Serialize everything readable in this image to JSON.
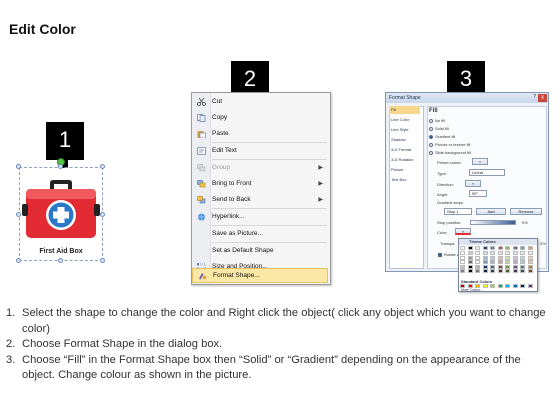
{
  "page_title": "Edit Color",
  "badges": [
    "1",
    "2",
    "3"
  ],
  "panel1": {
    "shape_label": "First Aid Box"
  },
  "context_menu": {
    "items": [
      {
        "label": "Cut",
        "icon": "scissors-icon",
        "arrow": false,
        "disabled": false
      },
      {
        "label": "Copy",
        "icon": "copy-icon",
        "arrow": false,
        "disabled": false
      },
      {
        "label": "Paste",
        "icon": "paste-icon",
        "arrow": false,
        "disabled": false
      },
      {
        "label": "Edit Text",
        "icon": "edit-text-icon",
        "arrow": false,
        "disabled": false
      },
      {
        "label": "Group",
        "icon": "group-icon",
        "arrow": true,
        "disabled": true
      },
      {
        "label": "Bring to Front",
        "icon": "bring-front-icon",
        "arrow": true,
        "disabled": false
      },
      {
        "label": "Send to Back",
        "icon": "send-back-icon",
        "arrow": true,
        "disabled": false
      },
      {
        "label": "Hyperlink...",
        "icon": "hyperlink-icon",
        "arrow": false,
        "disabled": false
      },
      {
        "label": "Save as Picture...",
        "icon": "",
        "arrow": false,
        "disabled": false
      },
      {
        "label": "Set as Default Shape",
        "icon": "",
        "arrow": false,
        "disabled": false
      },
      {
        "label": "Size and Position...",
        "icon": "size-icon",
        "arrow": false,
        "disabled": false
      },
      {
        "label": "Format Shape...",
        "icon": "format-shape-icon",
        "arrow": false,
        "disabled": false,
        "selected": true
      }
    ]
  },
  "format_dialog": {
    "title": "Format Shape",
    "help_button": "?",
    "close_button": "X",
    "nav_items": [
      "Fill",
      "Line Color",
      "Line Style",
      "Shadow",
      "3-D Format",
      "3-D Rotation",
      "Picture",
      "Text Box"
    ],
    "nav_selected": "Fill",
    "section_heading": "Fill",
    "fill_options": [
      "No fill",
      "Solid fill",
      "Gradient fill",
      "Picture or texture fill",
      "Slide background fill"
    ],
    "fill_selected": "Gradient fill",
    "labels": {
      "preset": "Preset colors:",
      "type": "Type:",
      "direction": "Direction:",
      "angle": "Angle:",
      "stops": "Gradient stops",
      "stop_position": "Stop position:",
      "color": "Color:",
      "transparency": "Transpa",
      "rotate": "Rotate with shape"
    },
    "values": {
      "type": "Linear",
      "angle": "90°",
      "stop": "Stop 1",
      "stop_pct": "0%",
      "transparency_pct": "0%"
    },
    "buttons": {
      "add": "Add",
      "remove": "Remove"
    }
  },
  "palette": {
    "theme_heading": "Theme Colors",
    "standard_heading": "Standard Colors",
    "more": "More Colors...",
    "theme_top_row": [
      "#ffffff",
      "#000000",
      "#eeece1",
      "#1f497d",
      "#4f81bd",
      "#c0504d",
      "#9bbb59",
      "#8064a2",
      "#4bacc6",
      "#f79646"
    ],
    "standard_row": [
      "#c00000",
      "#ff0000",
      "#ffc000",
      "#ffff00",
      "#92d050",
      "#00b050",
      "#00b0f0",
      "#0070c0",
      "#002060",
      "#7030a0"
    ]
  },
  "instructions": [
    {
      "num": "1.",
      "text": "Select the shape to change the color and Right click the object( click any object which you want to change color)"
    },
    {
      "num": "2.",
      "text": "Choose Format Shape in the dialog box."
    },
    {
      "num": "3.",
      "text": "Choose “Fill” in the Format Shape box then “Solid” or “Gradient” depending on the appearance of the object. Change colour as shown in the picture."
    }
  ],
  "colors": {
    "badge": "#000000",
    "aid_box_red": "#e32b33",
    "aid_cross_blue": "#2a78c8",
    "menu_highlight": "#fbe7a6"
  }
}
